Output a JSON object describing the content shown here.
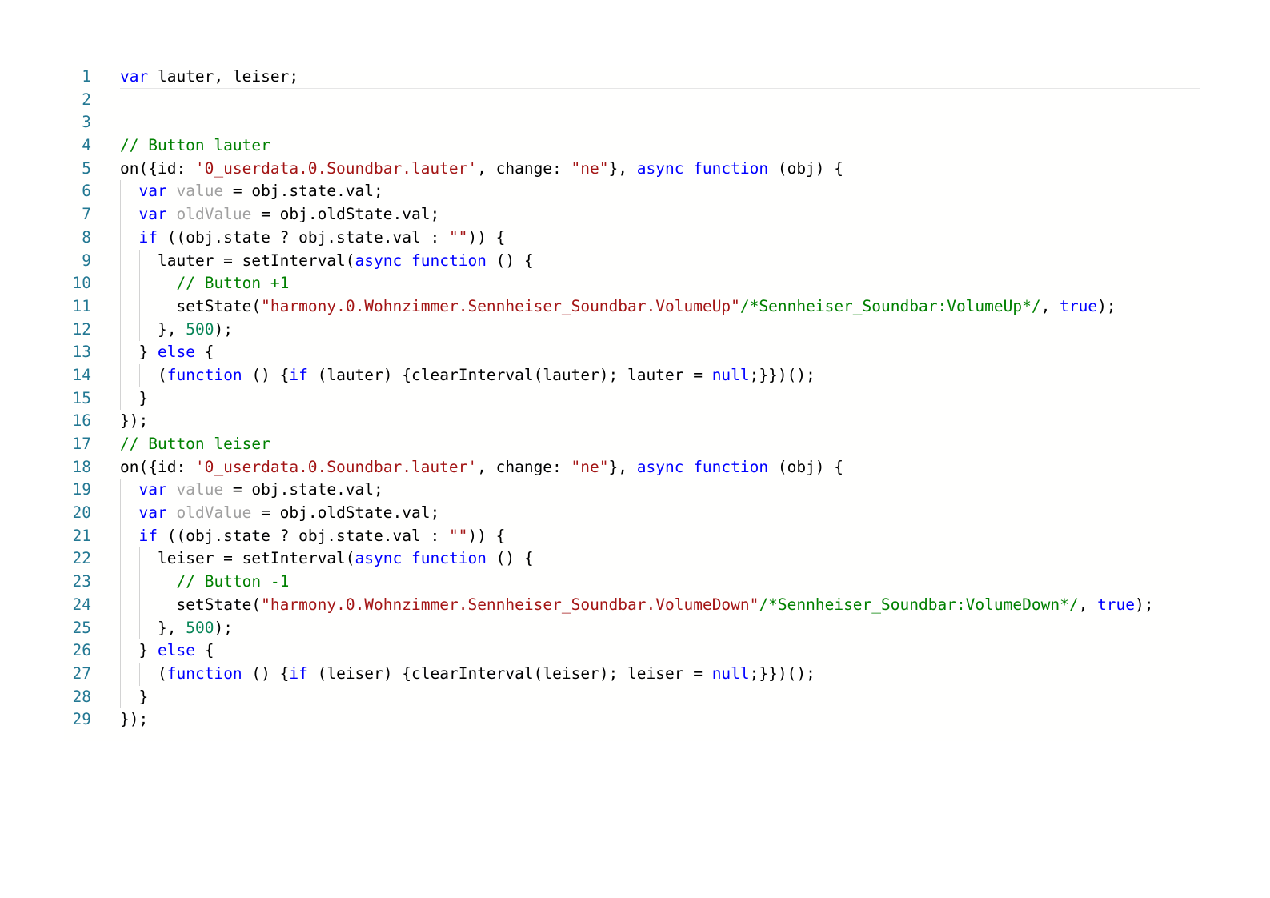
{
  "editor": {
    "language": "javascript",
    "current_line": 1,
    "lines": [
      {
        "number": "1",
        "indent": 0,
        "tokens": [
          [
            "k",
            "var"
          ],
          [
            "t",
            " lauter, leiser;"
          ]
        ]
      },
      {
        "number": "2",
        "indent": 0,
        "tokens": []
      },
      {
        "number": "3",
        "indent": 0,
        "tokens": []
      },
      {
        "number": "4",
        "indent": 0,
        "tokens": [
          [
            "c",
            "// Button lauter"
          ]
        ]
      },
      {
        "number": "5",
        "indent": 0,
        "tokens": [
          [
            "t",
            "on({id: "
          ],
          [
            "s",
            "'0_userdata.0.Soundbar.lauter'"
          ],
          [
            "t",
            ", change: "
          ],
          [
            "s",
            "\"ne\""
          ],
          [
            "t",
            "}, "
          ],
          [
            "k",
            "async"
          ],
          [
            "t",
            " "
          ],
          [
            "k",
            "function"
          ],
          [
            "t",
            " (obj) {"
          ]
        ]
      },
      {
        "number": "6",
        "indent": 1,
        "tokens": [
          [
            "k",
            "var"
          ],
          [
            "t",
            " "
          ],
          [
            "u",
            "value"
          ],
          [
            "t",
            " = obj.state.val;"
          ]
        ]
      },
      {
        "number": "7",
        "indent": 1,
        "tokens": [
          [
            "k",
            "var"
          ],
          [
            "t",
            " "
          ],
          [
            "u",
            "oldValue"
          ],
          [
            "t",
            " = obj.oldState.val;"
          ]
        ]
      },
      {
        "number": "8",
        "indent": 1,
        "tokens": [
          [
            "k",
            "if"
          ],
          [
            "t",
            " ((obj.state ? obj.state.val : "
          ],
          [
            "s",
            "\"\""
          ],
          [
            "t",
            ")) {"
          ]
        ]
      },
      {
        "number": "9",
        "indent": 2,
        "tokens": [
          [
            "t",
            "lauter = setInterval("
          ],
          [
            "k",
            "async"
          ],
          [
            "t",
            " "
          ],
          [
            "k",
            "function"
          ],
          [
            "t",
            " () {"
          ]
        ]
      },
      {
        "number": "10",
        "indent": 3,
        "tokens": [
          [
            "c",
            "// Button +1"
          ]
        ]
      },
      {
        "number": "11",
        "indent": 3,
        "tokens": [
          [
            "t",
            "setState("
          ],
          [
            "s",
            "\"harmony.0.Wohnzimmer.Sennheiser_Soundbar.VolumeUp\""
          ],
          [
            "c",
            "/*Sennheiser_Soundbar:VolumeUp*/"
          ],
          [
            "t",
            ", "
          ],
          [
            "k",
            "true"
          ],
          [
            "t",
            ");"
          ]
        ]
      },
      {
        "number": "12",
        "indent": 2,
        "tokens": [
          [
            "t",
            "}, "
          ],
          [
            "n",
            "500"
          ],
          [
            "t",
            ");"
          ]
        ]
      },
      {
        "number": "13",
        "indent": 1,
        "tokens": [
          [
            "t",
            "} "
          ],
          [
            "k",
            "else"
          ],
          [
            "t",
            " {"
          ]
        ]
      },
      {
        "number": "14",
        "indent": 2,
        "tokens": [
          [
            "t",
            "("
          ],
          [
            "k",
            "function"
          ],
          [
            "t",
            " () {"
          ],
          [
            "k",
            "if"
          ],
          [
            "t",
            " (lauter) {clearInterval(lauter); lauter = "
          ],
          [
            "k",
            "null"
          ],
          [
            "t",
            ";}})();"
          ]
        ]
      },
      {
        "number": "15",
        "indent": 1,
        "tokens": [
          [
            "t",
            "}"
          ]
        ]
      },
      {
        "number": "16",
        "indent": 0,
        "tokens": [
          [
            "t",
            "});"
          ]
        ]
      },
      {
        "number": "17",
        "indent": 0,
        "tokens": [
          [
            "c",
            "// Button leiser"
          ]
        ]
      },
      {
        "number": "18",
        "indent": 0,
        "tokens": [
          [
            "t",
            "on({id: "
          ],
          [
            "s",
            "'0_userdata.0.Soundbar.lauter'"
          ],
          [
            "t",
            ", change: "
          ],
          [
            "s",
            "\"ne\""
          ],
          [
            "t",
            "}, "
          ],
          [
            "k",
            "async"
          ],
          [
            "t",
            " "
          ],
          [
            "k",
            "function"
          ],
          [
            "t",
            " (obj) {"
          ]
        ]
      },
      {
        "number": "19",
        "indent": 1,
        "tokens": [
          [
            "k",
            "var"
          ],
          [
            "t",
            " "
          ],
          [
            "u",
            "value"
          ],
          [
            "t",
            " = obj.state.val;"
          ]
        ]
      },
      {
        "number": "20",
        "indent": 1,
        "tokens": [
          [
            "k",
            "var"
          ],
          [
            "t",
            " "
          ],
          [
            "u",
            "oldValue"
          ],
          [
            "t",
            " = obj.oldState.val;"
          ]
        ]
      },
      {
        "number": "21",
        "indent": 1,
        "tokens": [
          [
            "k",
            "if"
          ],
          [
            "t",
            " ((obj.state ? obj.state.val : "
          ],
          [
            "s",
            "\"\""
          ],
          [
            "t",
            ")) {"
          ]
        ]
      },
      {
        "number": "22",
        "indent": 2,
        "tokens": [
          [
            "t",
            "leiser = setInterval("
          ],
          [
            "k",
            "async"
          ],
          [
            "t",
            " "
          ],
          [
            "k",
            "function"
          ],
          [
            "t",
            " () {"
          ]
        ]
      },
      {
        "number": "23",
        "indent": 3,
        "tokens": [
          [
            "c",
            "// Button -1"
          ]
        ]
      },
      {
        "number": "24",
        "indent": 3,
        "tokens": [
          [
            "t",
            "setState("
          ],
          [
            "s",
            "\"harmony.0.Wohnzimmer.Sennheiser_Soundbar.VolumeDown\""
          ],
          [
            "c",
            "/*Sennheiser_Soundbar:VolumeDown*/"
          ],
          [
            "t",
            ", "
          ],
          [
            "k",
            "true"
          ],
          [
            "t",
            ");"
          ]
        ]
      },
      {
        "number": "25",
        "indent": 2,
        "tokens": [
          [
            "t",
            "}, "
          ],
          [
            "n",
            "500"
          ],
          [
            "t",
            ");"
          ]
        ]
      },
      {
        "number": "26",
        "indent": 1,
        "tokens": [
          [
            "t",
            "} "
          ],
          [
            "k",
            "else"
          ],
          [
            "t",
            " {"
          ]
        ]
      },
      {
        "number": "27",
        "indent": 2,
        "tokens": [
          [
            "t",
            "("
          ],
          [
            "k",
            "function"
          ],
          [
            "t",
            " () {"
          ],
          [
            "k",
            "if"
          ],
          [
            "t",
            " (leiser) {clearInterval(leiser); leiser = "
          ],
          [
            "k",
            "null"
          ],
          [
            "t",
            ";}})();"
          ]
        ]
      },
      {
        "number": "28",
        "indent": 1,
        "tokens": [
          [
            "t",
            "}"
          ]
        ]
      },
      {
        "number": "29",
        "indent": 0,
        "tokens": [
          [
            "t",
            "});"
          ]
        ]
      }
    ]
  }
}
